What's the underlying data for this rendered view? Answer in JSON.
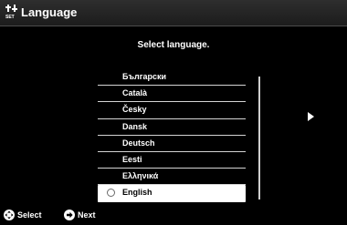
{
  "header": {
    "title": "Language",
    "icon": "tools-icon"
  },
  "main": {
    "prompt": "Select language.",
    "languages": [
      {
        "label": "Български",
        "selected": false
      },
      {
        "label": "Català",
        "selected": false
      },
      {
        "label": "Česky",
        "selected": false
      },
      {
        "label": "Dansk",
        "selected": false
      },
      {
        "label": "Deutsch",
        "selected": false
      },
      {
        "label": "Eesti",
        "selected": false
      },
      {
        "label": "Ελληνικά",
        "selected": false
      },
      {
        "label": "English",
        "selected": true
      }
    ],
    "next_icon": "play-right-icon"
  },
  "footer": {
    "select_label": "Select",
    "select_icon": "dpad-icon",
    "next_label": "Next",
    "next_icon": "arrow-circle-icon"
  },
  "colors": {
    "background": "#000000",
    "highlight": "#ffffff",
    "text": "#ffffff"
  }
}
